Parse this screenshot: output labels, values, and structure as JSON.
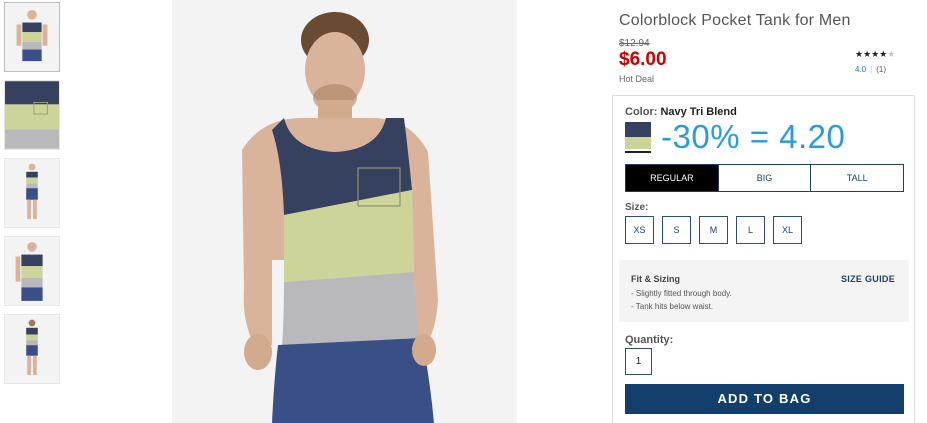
{
  "product": {
    "title": "Colorblock Pocket Tank for Men",
    "old_price": "$12.94",
    "sale_price": "$6.00",
    "deal_label": "Hot Deal",
    "rating": {
      "stars_filled": 4,
      "stars_total": 5,
      "average": "4.0",
      "count": "(1)"
    }
  },
  "color": {
    "label": "Color:",
    "value": "Navy Tri Blend"
  },
  "promo_text": "-30% = 4.20",
  "fit_tabs": [
    "REGULAR",
    "BIG",
    "TALL"
  ],
  "selected_fit": "REGULAR",
  "size": {
    "label": "Size:",
    "options": [
      "XS",
      "S",
      "M",
      "L",
      "XL"
    ]
  },
  "fit_sizing": {
    "title": "Fit & Sizing",
    "guide_link": "SIZE GUIDE",
    "notes": [
      "- Slightly fitted through body.",
      "- Tank hits below waist."
    ]
  },
  "quantity": {
    "label": "Quantity:",
    "value": "1"
  },
  "add_to_bag_label": "ADD TO BAG",
  "colors": {
    "sale_red": "#cc0000",
    "promo_blue": "#2a9be0",
    "navy": "#123f6b",
    "shirt_navy": "#36415f",
    "shirt_yellow": "#cdd49a",
    "shirt_grey": "#b9b9bb",
    "shorts_blue": "#3a4f86"
  },
  "thumbnails": [
    {
      "view": "front-full",
      "selected": true
    },
    {
      "view": "fabric-closeup",
      "selected": false
    },
    {
      "view": "front-small",
      "selected": false
    },
    {
      "view": "side",
      "selected": false
    },
    {
      "view": "back",
      "selected": false
    }
  ]
}
